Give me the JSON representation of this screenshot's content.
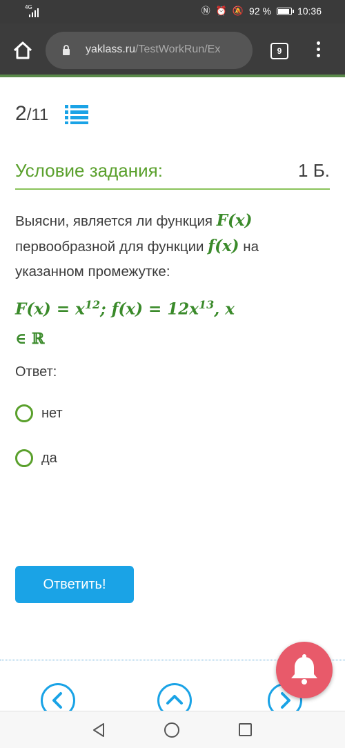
{
  "status_bar": {
    "network": "4G",
    "battery_percent": "92 %",
    "battery_level": 0.92,
    "time": "10:36",
    "icons": [
      "nfc-icon",
      "alarm-icon",
      "mute-icon",
      "battery-icon"
    ]
  },
  "browser": {
    "url_domain": "yaklass.ru",
    "url_path": "/TestWorkRun/Ex",
    "tab_count": "9"
  },
  "task": {
    "counter_current": "2",
    "counter_total": "/11",
    "title": "Условие задания:",
    "points": "1 Б.",
    "q_part1": "Выясни, является ли функция ",
    "q_F": "F(x)",
    "q_part2": " первообразной для функции ",
    "q_f": "f(x)",
    "q_part3": " на указанном промежутке:",
    "formula_line1_a": "F(x) = x",
    "formula_line1_exp1": "12",
    "formula_line1_b": "; f(x) = 12x",
    "formula_line1_exp2": "13",
    "formula_line1_c": ", x",
    "formula_line2": "∈ ℝ",
    "answer_label": "Ответ:",
    "options": [
      {
        "label": "нет"
      },
      {
        "label": "да"
      }
    ],
    "submit_label": "Ответить!"
  },
  "colors": {
    "accent_green": "#5aa02c",
    "formula_green": "#3a8a2a",
    "button_blue": "#1aa3e6",
    "fab_red": "#e85a6a"
  }
}
